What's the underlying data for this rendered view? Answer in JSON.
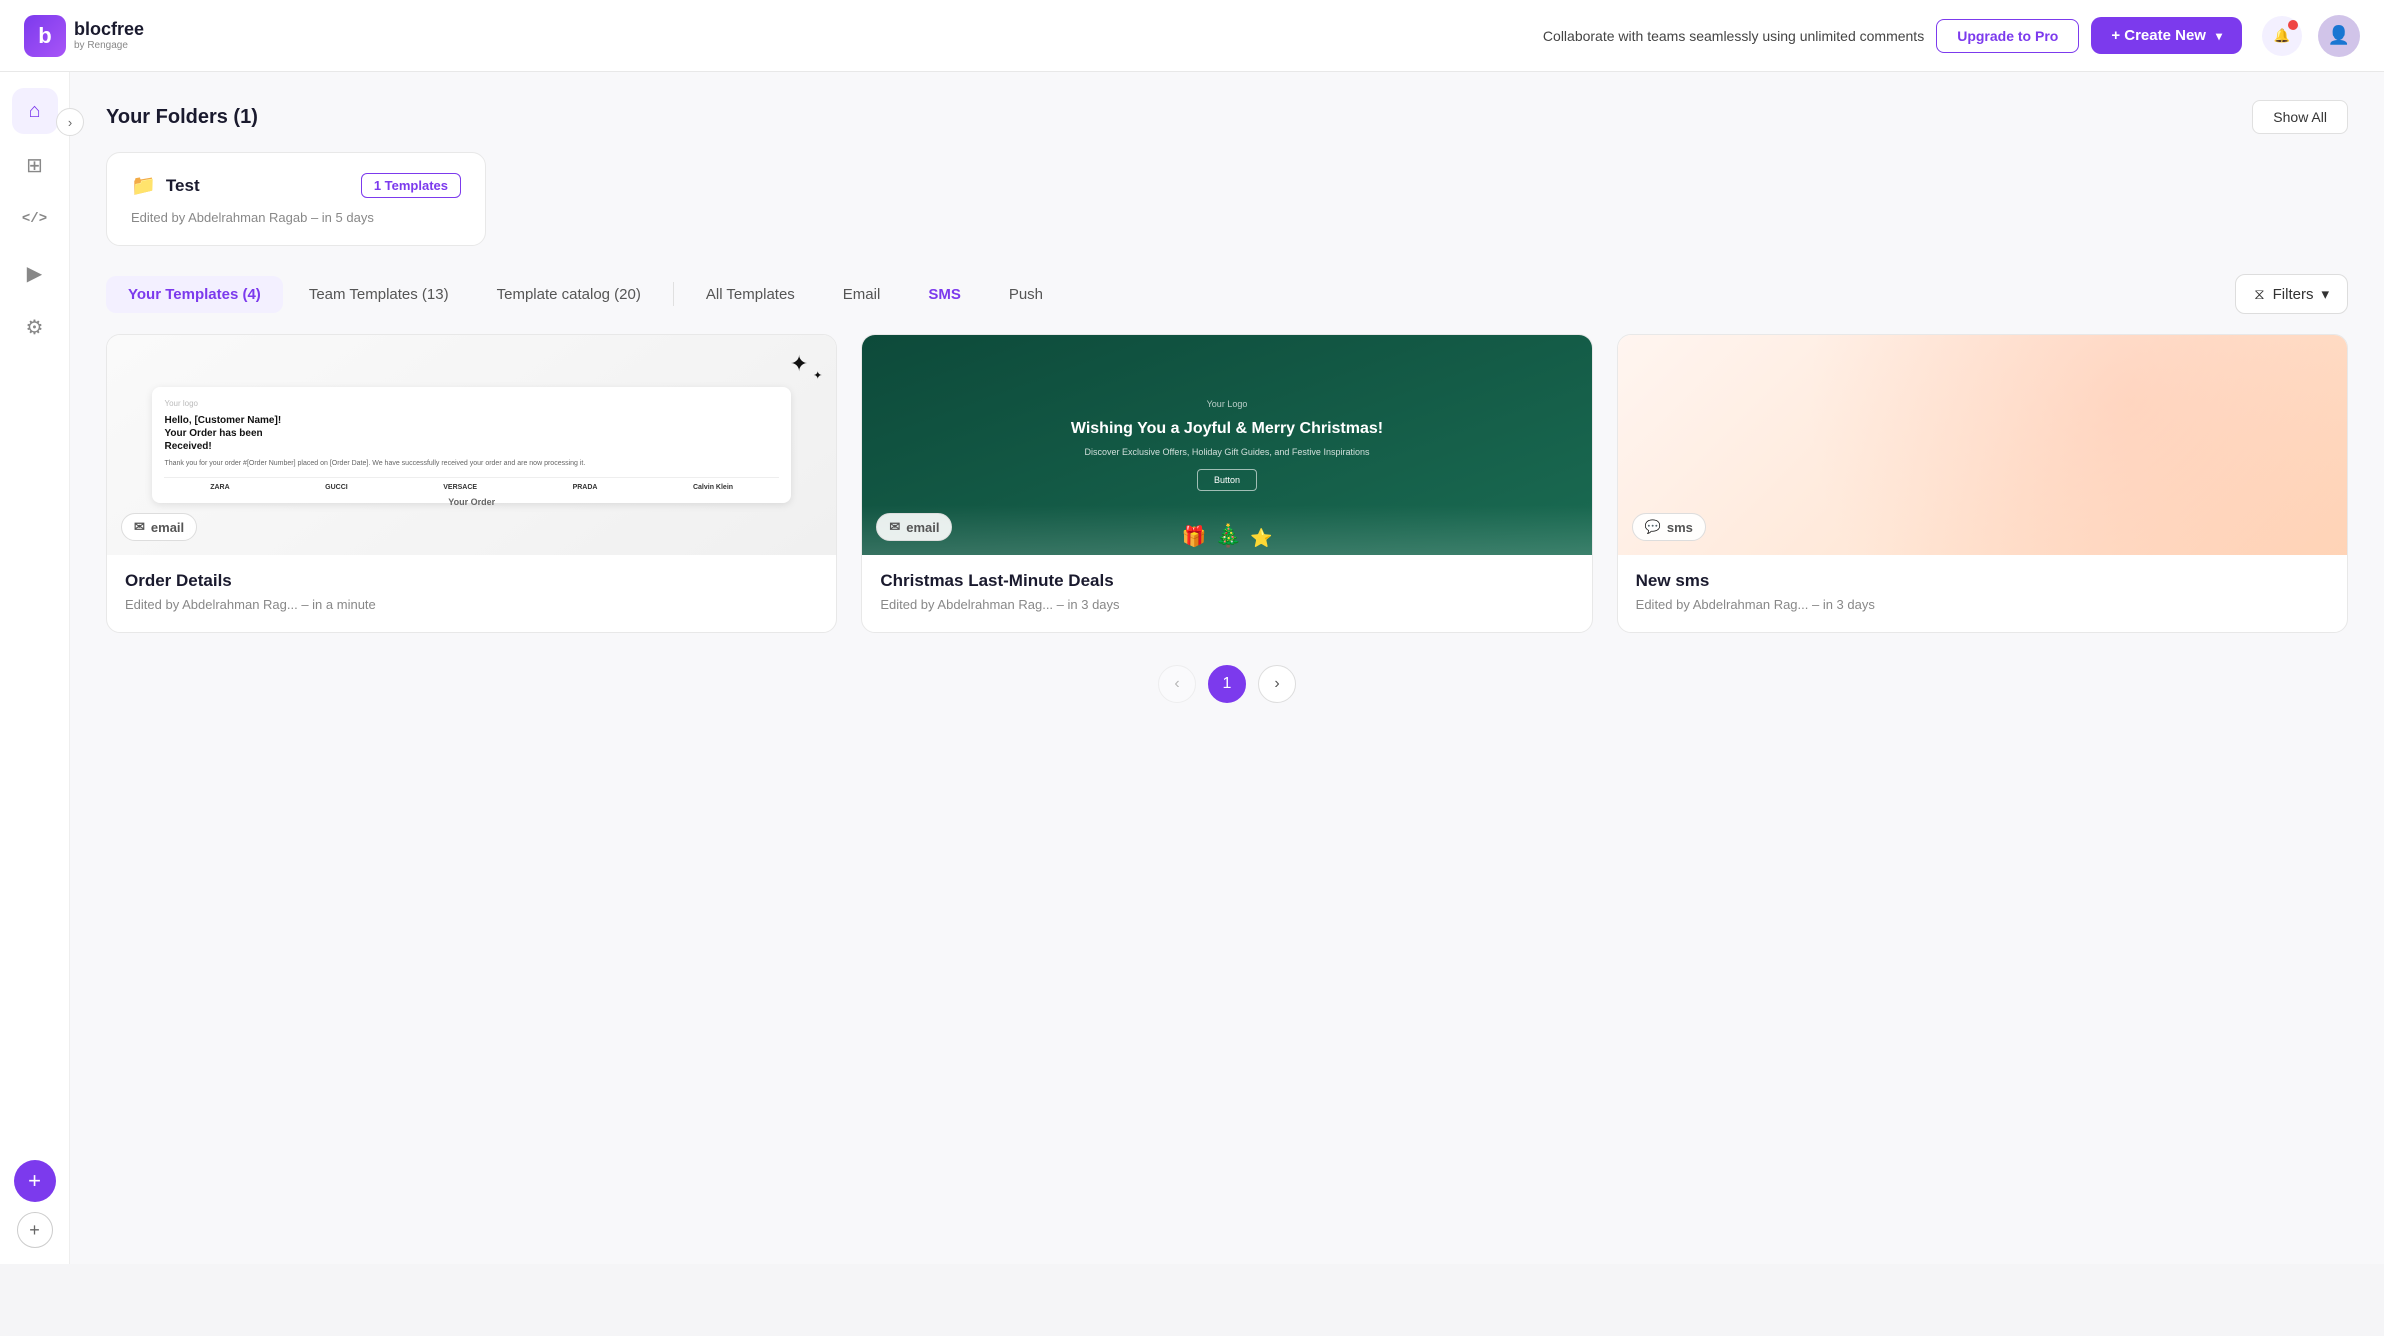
{
  "app": {
    "logo_letter": "b",
    "logo_name": "blocfree",
    "logo_sub": "by Rengage"
  },
  "topnav": {
    "promo_text": "Collaborate with teams seamlessly using unlimited comments",
    "upgrade_label": "Upgrade to Pro",
    "create_label": "+ Create New"
  },
  "sidebar": {
    "items": [
      {
        "name": "home",
        "icon": "⌂",
        "label": "Home"
      },
      {
        "name": "templates",
        "icon": "⊞",
        "label": "Templates"
      },
      {
        "name": "code",
        "icon": "</>",
        "label": "Code"
      },
      {
        "name": "play",
        "icon": "▶",
        "label": "Play"
      },
      {
        "name": "settings",
        "icon": "⚙",
        "label": "Settings"
      }
    ]
  },
  "folders": {
    "section_title": "Your Folders (1)",
    "show_all_label": "Show All",
    "items": [
      {
        "name": "Test",
        "badge": "1 Templates",
        "meta": "Edited by Abdelrahman Ragab – in 5 days"
      }
    ]
  },
  "tabs": {
    "items": [
      {
        "label": "Your Templates (4)",
        "active": true
      },
      {
        "label": "Team Templates (13)",
        "active": false
      },
      {
        "label": "Template catalog (20)",
        "active": false
      },
      {
        "label": "All Templates",
        "active": false
      },
      {
        "label": "Email",
        "active": false
      },
      {
        "label": "SMS",
        "active": false
      },
      {
        "label": "Push",
        "active": false
      }
    ],
    "filters_label": "Filters"
  },
  "templates": [
    {
      "name": "Order Details",
      "meta": "Edited by Abdelrahman Rag... – in a minute",
      "type": "email",
      "badge_label": "email"
    },
    {
      "name": "Christmas Last-Minute Deals",
      "meta": "Edited by Abdelrahman Rag... – in 3 days",
      "type": "email",
      "badge_label": "email"
    },
    {
      "name": "New sms",
      "meta": "Edited by Abdelrahman Rag... – in 3 days",
      "type": "sms",
      "badge_label": "sms"
    }
  ],
  "pagination": {
    "current": 1,
    "prev_label": "‹",
    "next_label": "›"
  }
}
